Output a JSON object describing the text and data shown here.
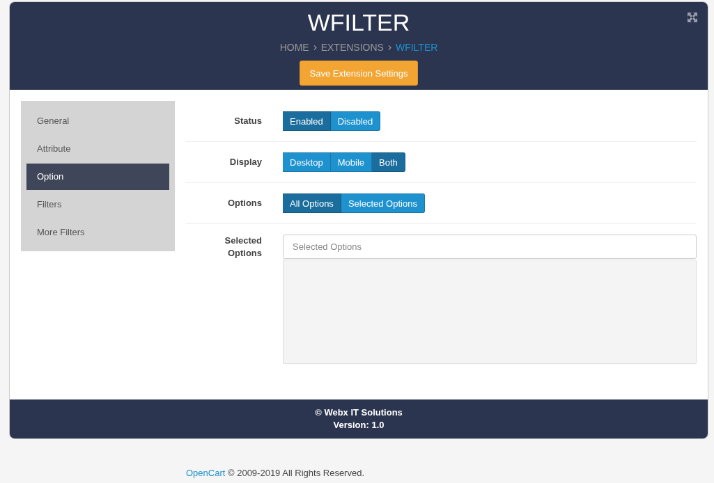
{
  "header": {
    "title": "WFILTER",
    "breadcrumb": [
      {
        "label": "HOME",
        "current": false
      },
      {
        "label": "EXTENSIONS",
        "current": false
      },
      {
        "label": "WFILTER",
        "current": true
      }
    ],
    "save_button": "Save Extension Settings"
  },
  "sidebar": {
    "items": [
      {
        "label": "General",
        "selected": false
      },
      {
        "label": "Attribute",
        "selected": false
      },
      {
        "label": "Option",
        "selected": true
      },
      {
        "label": "Filters",
        "selected": false
      },
      {
        "label": "More Filters",
        "selected": false
      }
    ]
  },
  "fields": [
    {
      "kind": "toggle",
      "label": "Status",
      "options": [
        {
          "label": "Enabled",
          "selected": true
        },
        {
          "label": "Disabled",
          "selected": false
        }
      ]
    },
    {
      "kind": "toggle",
      "label": "Display",
      "options": [
        {
          "label": "Desktop",
          "selected": false
        },
        {
          "label": "Mobile",
          "selected": false
        },
        {
          "label": "Both",
          "selected": true
        }
      ]
    },
    {
      "kind": "toggle",
      "label": "Options",
      "options": [
        {
          "label": "All Options",
          "selected": true
        },
        {
          "label": "Selected Options",
          "selected": false
        }
      ]
    },
    {
      "kind": "select-list",
      "label": "Selected Options",
      "placeholder": "Selected Options"
    }
  ],
  "footer": {
    "copyright": "© Webx IT Solutions",
    "version": "Version: 1.0"
  },
  "page_footer": {
    "link": "OpenCart",
    "text": " © 2009-2019 All Rights Reserved."
  }
}
